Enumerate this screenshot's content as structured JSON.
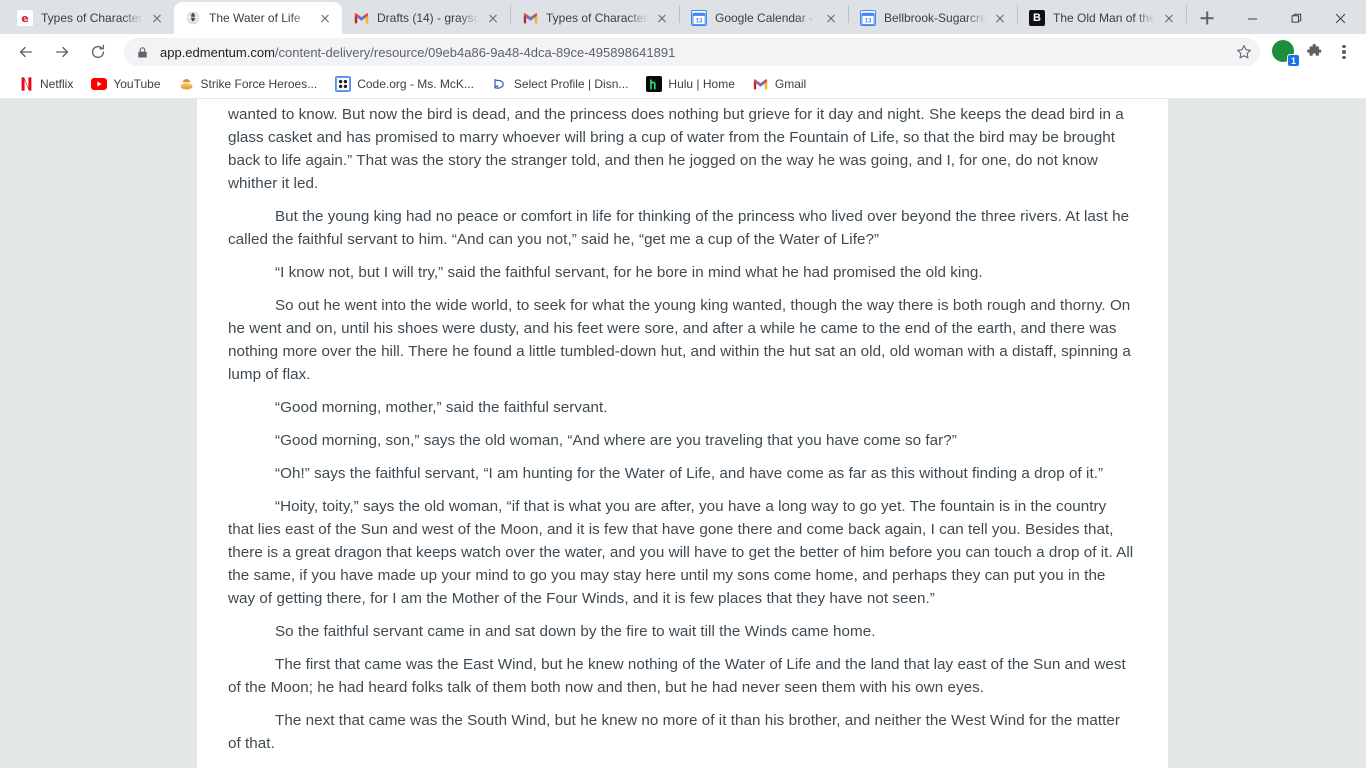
{
  "browser": {
    "tabs": [
      {
        "title": "Types of Character",
        "favicon": "edmentum-e-icon",
        "active": false,
        "sep_after": false
      },
      {
        "title": "The Water of Life",
        "favicon": "globe-icon",
        "active": true,
        "sep_after": false
      },
      {
        "title": "Drafts (14) - graysc",
        "favicon": "gmail-icon",
        "active": false,
        "sep_after": true
      },
      {
        "title": "Types of Character",
        "favicon": "gmail-icon",
        "active": false,
        "sep_after": true
      },
      {
        "title": "Google Calendar - W",
        "favicon": "google-calendar-icon",
        "active": false,
        "sep_after": true
      },
      {
        "title": "Bellbrook-Sugarcre",
        "favicon": "google-calendar-icon",
        "active": false,
        "sep_after": true
      },
      {
        "title": "The Old Man of the",
        "favicon": "blackboard-b-icon",
        "active": false,
        "sep_after": true
      }
    ],
    "new_tab_label": "+",
    "window_controls": {
      "minimize": "minimize-icon",
      "maximize": "restore-icon",
      "close": "close-icon"
    },
    "nav": {
      "back": "back-arrow-icon",
      "forward": "forward-arrow-icon",
      "reload": "reload-icon"
    },
    "omnibox": {
      "lock": "lock-icon",
      "host": "app.edmentum.com",
      "path": "/content-delivery/resource/09eb4a86-9a48-4dca-89ce-495898641891",
      "star": "star-icon"
    },
    "toolbar_icons": {
      "profile_avatar": "profile-avatar",
      "profile_badge": "1",
      "extensions": "puzzle-piece-icon",
      "menu": "three-dot-menu-icon"
    },
    "bookmarks": [
      {
        "label": "Netflix",
        "icon": "netflix-icon",
        "glyph": "N"
      },
      {
        "label": "YouTube",
        "icon": "youtube-icon",
        "glyph": "▶"
      },
      {
        "label": "Strike Force Heroes...",
        "icon": "strike-force-heroes-icon",
        "glyph": "🍜"
      },
      {
        "label": "Code.org - Ms. McK...",
        "icon": "code-org-icon",
        "glyph": "⁙"
      },
      {
        "label": "Select Profile | Disn...",
        "icon": "disney-plus-icon",
        "glyph": "𝒟"
      },
      {
        "label": "Hulu | Home",
        "icon": "hulu-icon",
        "glyph": "h"
      },
      {
        "label": "Gmail",
        "icon": "gmail-icon",
        "glyph": "M"
      }
    ]
  },
  "page": {
    "paragraphs": [
      {
        "indent": false,
        "text": "wanted to know. But now the bird is dead, and the princess does nothing but grieve for it day and night. She keeps the dead bird in a glass casket and has promised to marry whoever will bring a cup of water from the Fountain of Life, so that the bird may be brought back to life again.” That was the story the stranger told, and then he jogged on the way he was going, and I, for one, do not know whither it led."
      },
      {
        "indent": true,
        "text": "But the young king had no peace or comfort in life for thinking of the princess who lived over beyond the three rivers. At last he called the faithful servant to him. “And can you not,” said he, “get me a cup of the Water of Life?”"
      },
      {
        "indent": true,
        "text": "“I know not, but I will try,” said the faithful servant, for he bore in mind what he had promised the old king."
      },
      {
        "indent": true,
        "text": "So out he went into the wide world, to seek for what the young king wanted, though the way there is both rough and thorny. On he went and on, until his shoes were dusty, and his feet were sore, and after a while he came to the end of the earth, and there was nothing more over the hill. There he found a little tumbled-down hut, and within the hut sat an old, old woman with a distaff, spinning a lump of flax."
      },
      {
        "indent": true,
        "text": "“Good morning, mother,” said the faithful servant."
      },
      {
        "indent": true,
        "text": "“Good morning, son,” says the old woman, “And where are you traveling that you have come so far?”"
      },
      {
        "indent": true,
        "text": "“Oh!” says the faithful servant, “I am hunting for the Water of Life, and have come as far as this without finding a drop of it.”"
      },
      {
        "indent": true,
        "text": "“Hoity, toity,” says the old woman, “if that is what you are after, you have a long way to go yet. The fountain is in the country that lies east of the Sun and west of the Moon, and it is few that have gone there and come back again, I can tell you. Besides that, there is a great dragon that keeps watch over the water, and you will have to get the better of him before you can touch a drop of it. All the same, if you have made up your mind to go you may stay here until my sons come home, and perhaps they can put  you in the way of getting there, for I am the Mother of the Four Winds, and it is few places that they have not seen.”"
      },
      {
        "indent": true,
        "text": "So the faithful servant came in and sat down by the fire to wait till the Winds came home."
      },
      {
        "indent": true,
        "text": "The first that came was the East Wind, but he knew nothing of the Water of Life and the land that lay east of the Sun and west of the Moon; he had heard folks talk of them both now and then, but he had never seen them with his own eyes."
      },
      {
        "indent": true,
        "text": "The next that came was the South Wind, but he knew no more of it than his brother, and neither the West Wind for the matter of that."
      }
    ]
  },
  "colors": {
    "chrome_frame": "#dee1e6",
    "toolbar_bg": "#ffffff",
    "omnibox_bg": "#f1f3f4",
    "page_bg": "#e3e7e8",
    "content_bg": "#ffffff",
    "text": "#3e4a52",
    "accent_blue": "#1a73e8",
    "profile_green": "#1e8e3e"
  }
}
